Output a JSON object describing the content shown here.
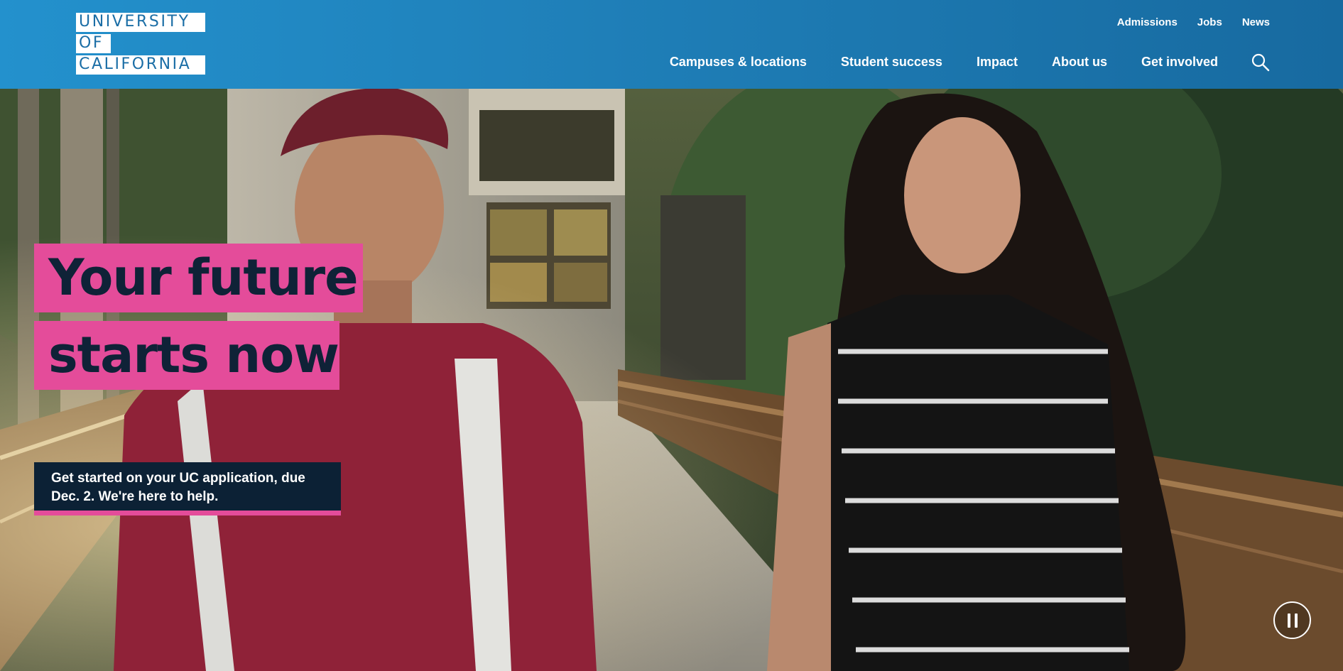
{
  "logo": {
    "line1": "UNIVERSITY",
    "line2": "OF",
    "line3": "CALIFORNIA"
  },
  "utility_nav": [
    "Admissions",
    "Jobs",
    "News"
  ],
  "main_nav": [
    "Campuses & locations",
    "Student success",
    "Impact",
    "About us",
    "Get involved"
  ],
  "search_icon": "search-icon",
  "hero": {
    "headline_line1": "Your future",
    "headline_line2": "starts now",
    "cta_text": "Get started on your UC application, due Dec. 2. We're here to help.",
    "pause_icon": "pause-icon"
  },
  "colors": {
    "header_blue": "#1f7fb8",
    "accent_pink": "#e44c9a",
    "navy": "#0c2135"
  }
}
